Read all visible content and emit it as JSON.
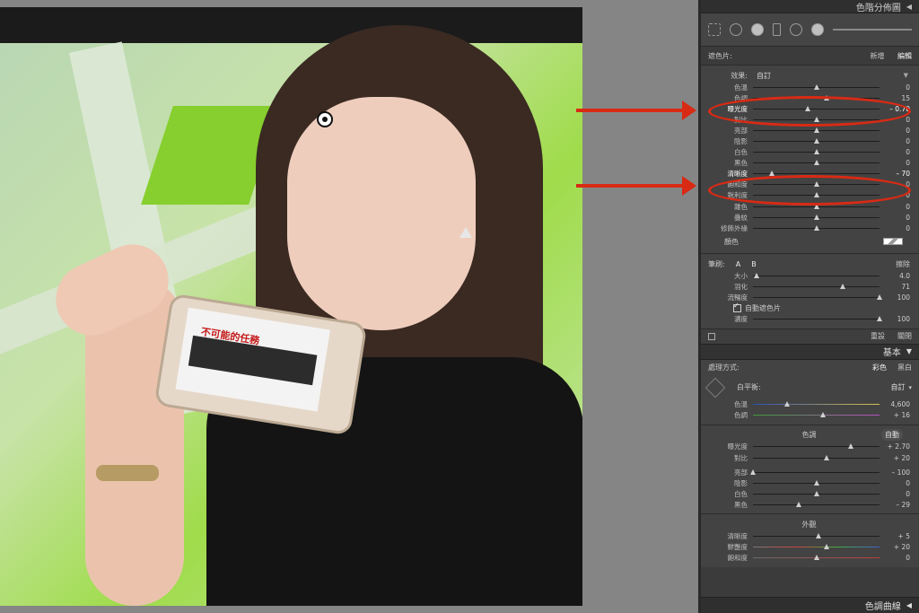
{
  "panel": {
    "histogram_title": "色階分佈圖",
    "mask": {
      "label": "遮色片:",
      "new": "新增",
      "edit": "編輯"
    },
    "effect": {
      "label": "效果:",
      "value": "自訂"
    },
    "local_sliders": [
      {
        "label": "色溫",
        "value": "0",
        "pos": 0.5
      },
      {
        "label": "色調",
        "value": "15",
        "pos": 0.58
      },
      {
        "label": "曝光度",
        "value": "– 0.70",
        "pos": 0.43,
        "highlight": true
      },
      {
        "label": "對比",
        "value": "0",
        "pos": 0.5
      },
      {
        "label": "亮部",
        "value": "0",
        "pos": 0.5
      },
      {
        "label": "陰影",
        "value": "0",
        "pos": 0.5
      },
      {
        "label": "白色",
        "value": "0",
        "pos": 0.5
      },
      {
        "label": "黑色",
        "value": "0",
        "pos": 0.5
      },
      {
        "label": "清晰度",
        "value": "– 70",
        "pos": 0.15,
        "highlight": true
      },
      {
        "label": "飽和度",
        "value": "0",
        "pos": 0.5
      },
      {
        "label": "銳利度",
        "value": "0",
        "pos": 0.5
      },
      {
        "label": "雜色",
        "value": "0",
        "pos": 0.5
      },
      {
        "label": "疊紋",
        "value": "0",
        "pos": 0.5
      },
      {
        "label": "修飾外緣",
        "value": "0",
        "pos": 0.5
      }
    ],
    "color_label": "顏色",
    "brush": {
      "label": "筆刷:",
      "a": "A",
      "b": "B",
      "erase": "擦除",
      "sliders": [
        {
          "label": "大小",
          "value": "4.0",
          "pos": 0.03
        },
        {
          "label": "羽化",
          "value": "71",
          "pos": 0.71
        },
        {
          "label": "流暢度",
          "value": "100",
          "pos": 1.0
        }
      ],
      "auto_mask": "自動遮色片",
      "density": {
        "label": "濃度",
        "value": "100",
        "pos": 1.0
      }
    },
    "footer": {
      "reset": "重設",
      "close": "關閉"
    },
    "basic": {
      "title": "基本",
      "treatment_label": "處理方式:",
      "color": "彩色",
      "bw": "黑白",
      "wb_label": "白平衡:",
      "wb_value": "自訂",
      "temp": {
        "label": "色溫",
        "value": "4,600",
        "pos": 0.27
      },
      "tint": {
        "label": "色調",
        "value": "+ 16",
        "pos": 0.55
      },
      "tone_title": "色調",
      "auto": "自動",
      "tone_sliders": [
        {
          "label": "曝光度",
          "value": "+ 2.70",
          "pos": 0.77
        },
        {
          "label": "對比",
          "value": "+ 20",
          "pos": 0.58
        }
      ],
      "light_sliders": [
        {
          "label": "亮部",
          "value": "– 100",
          "pos": 0.0
        },
        {
          "label": "陰影",
          "value": "0",
          "pos": 0.5
        },
        {
          "label": "白色",
          "value": "0",
          "pos": 0.5
        },
        {
          "label": "黑色",
          "value": "– 29",
          "pos": 0.36
        }
      ],
      "presence_title": "外觀",
      "presence_sliders": [
        {
          "label": "清晰度",
          "value": "+ 5",
          "pos": 0.52
        },
        {
          "label": "鮮艷度",
          "value": "+ 20",
          "pos": 0.58
        },
        {
          "label": "飽和度",
          "value": "0",
          "pos": 0.5
        }
      ]
    },
    "tone_curve_title": "色調曲線"
  },
  "photo": {
    "poster_text": "不可能的任務"
  }
}
